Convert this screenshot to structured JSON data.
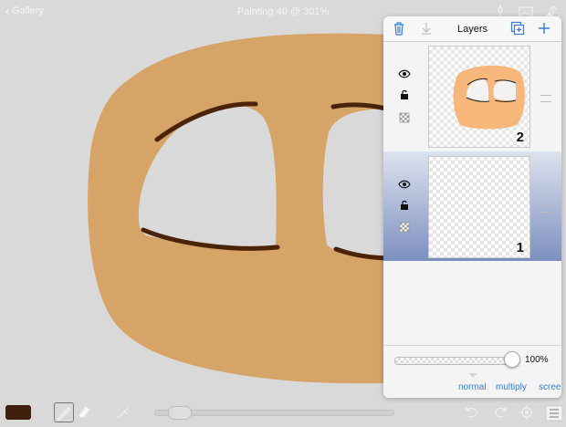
{
  "app": {
    "back_label": "Gallery",
    "title": "Painting 40 @ 301%"
  },
  "topbar_icons": [
    "brush-pin-icon",
    "image-icon",
    "share-icon"
  ],
  "layers_panel": {
    "title": "Layers",
    "header_icons": [
      "trash-icon",
      "merge-down-icon",
      "duplicate-layer-icon",
      "add-layer-icon"
    ],
    "layers": [
      {
        "number": "2",
        "selected": false,
        "visible": true,
        "locked": true
      },
      {
        "number": "1",
        "selected": true,
        "visible": true,
        "locked": true
      }
    ],
    "opacity": {
      "label": "100%",
      "value": 1.0
    },
    "blend_modes": [
      "normal",
      "multiply",
      "scree"
    ]
  },
  "bottom_toolbar": {
    "current_color": "#3d1f0c",
    "tools": [
      "pencil-tool",
      "eraser-tool",
      "smudge-tool"
    ],
    "right_icons": [
      "undo-icon",
      "redo-icon",
      "settings-icon",
      "layers-icon"
    ]
  },
  "colors": {
    "skin": "#d7a468",
    "outline": "#4a2309",
    "accent_blue": "#3a7cd5",
    "selected_layer": "#7d8fbf"
  }
}
